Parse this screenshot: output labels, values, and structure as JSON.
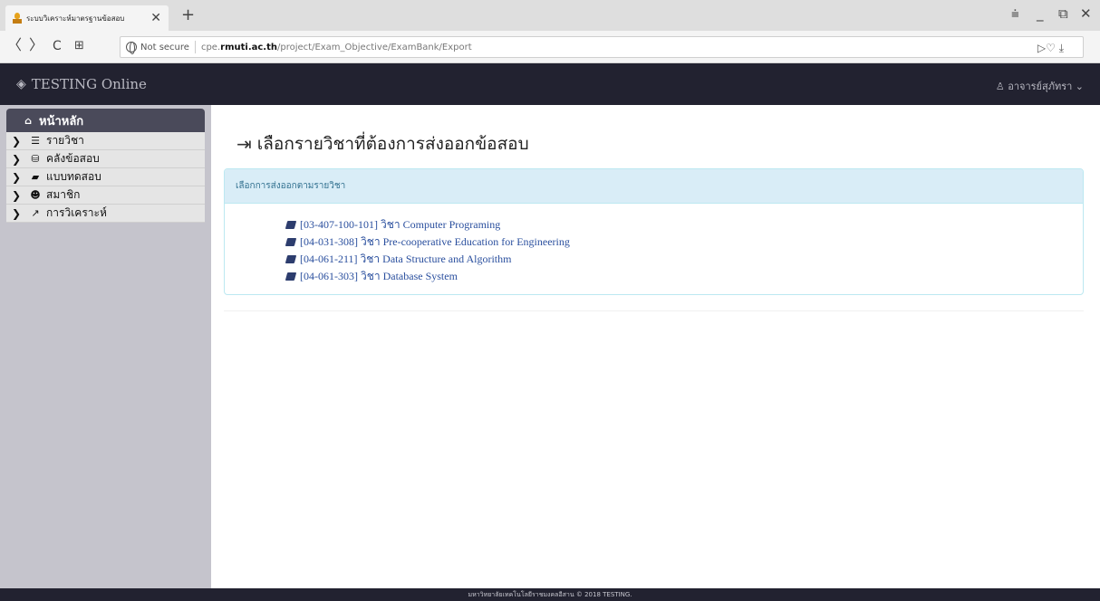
{
  "browser": {
    "tab_title": "ระบบวิเคราะห์มาตรฐานข้อสอบ",
    "tab_close": "✕",
    "new_tab": "+",
    "controls": {
      "menu": "⩧",
      "minimize": "_",
      "restore": "⧉",
      "close": "✕"
    },
    "nav": {
      "back": "〈",
      "forward": "〉",
      "reload": "C",
      "apps": "⊞"
    },
    "not_secure": "Not secure",
    "url_prefix": "cpe.",
    "url_host": "rmuti.ac.th",
    "url_path": "/project/Exam_Objective/ExamBank/Export",
    "url_right": "▷♡   ⤓"
  },
  "navbar": {
    "brand_icon": "layers-icon",
    "brand": "TESTING Online",
    "user_icon": "user-icon",
    "user": "อาจารย์สุภัทรา ⌄"
  },
  "sidebar": {
    "home": {
      "icon": "home-icon",
      "label": "หน้าหลัก"
    },
    "items": [
      {
        "icon": "list-icon",
        "glyph": "☰",
        "label": "รายวิชา"
      },
      {
        "icon": "database-icon",
        "glyph": "⛁",
        "label": "คลังข้อสอบ"
      },
      {
        "icon": "book-icon",
        "glyph": "▰",
        "label": "แบบทดสอบ"
      },
      {
        "icon": "users-icon",
        "glyph": "☻",
        "label": "สมาชิก"
      },
      {
        "icon": "line-chart-icon",
        "glyph": "↗",
        "label": "การวิเคราะห์"
      }
    ]
  },
  "main": {
    "title_icon": "sign-in-icon",
    "title": "เลือกรายวิชาที่ต้องการส่งออกข้อสอบ",
    "panel_heading": "เลือกการส่งออกตามรายวิชา",
    "courses": [
      "[03-407-100-101] วิชา Computer Programing",
      "[04-031-308] วิชา Pre-cooperative Education for Engineering",
      "[04-061-211] วิชา Data Structure and Algorithm",
      "[04-061-303] วิชา Database System"
    ]
  },
  "footer": "มหาวิทยาลัยเทคโนโลยีราชมงคลอีสาน © 2018 TESTING.",
  "colors": {
    "navbar": "#222230",
    "sidebar": "#c5c4cc",
    "panel_heading": "#d9edf7",
    "link": "#2a4f9e"
  }
}
